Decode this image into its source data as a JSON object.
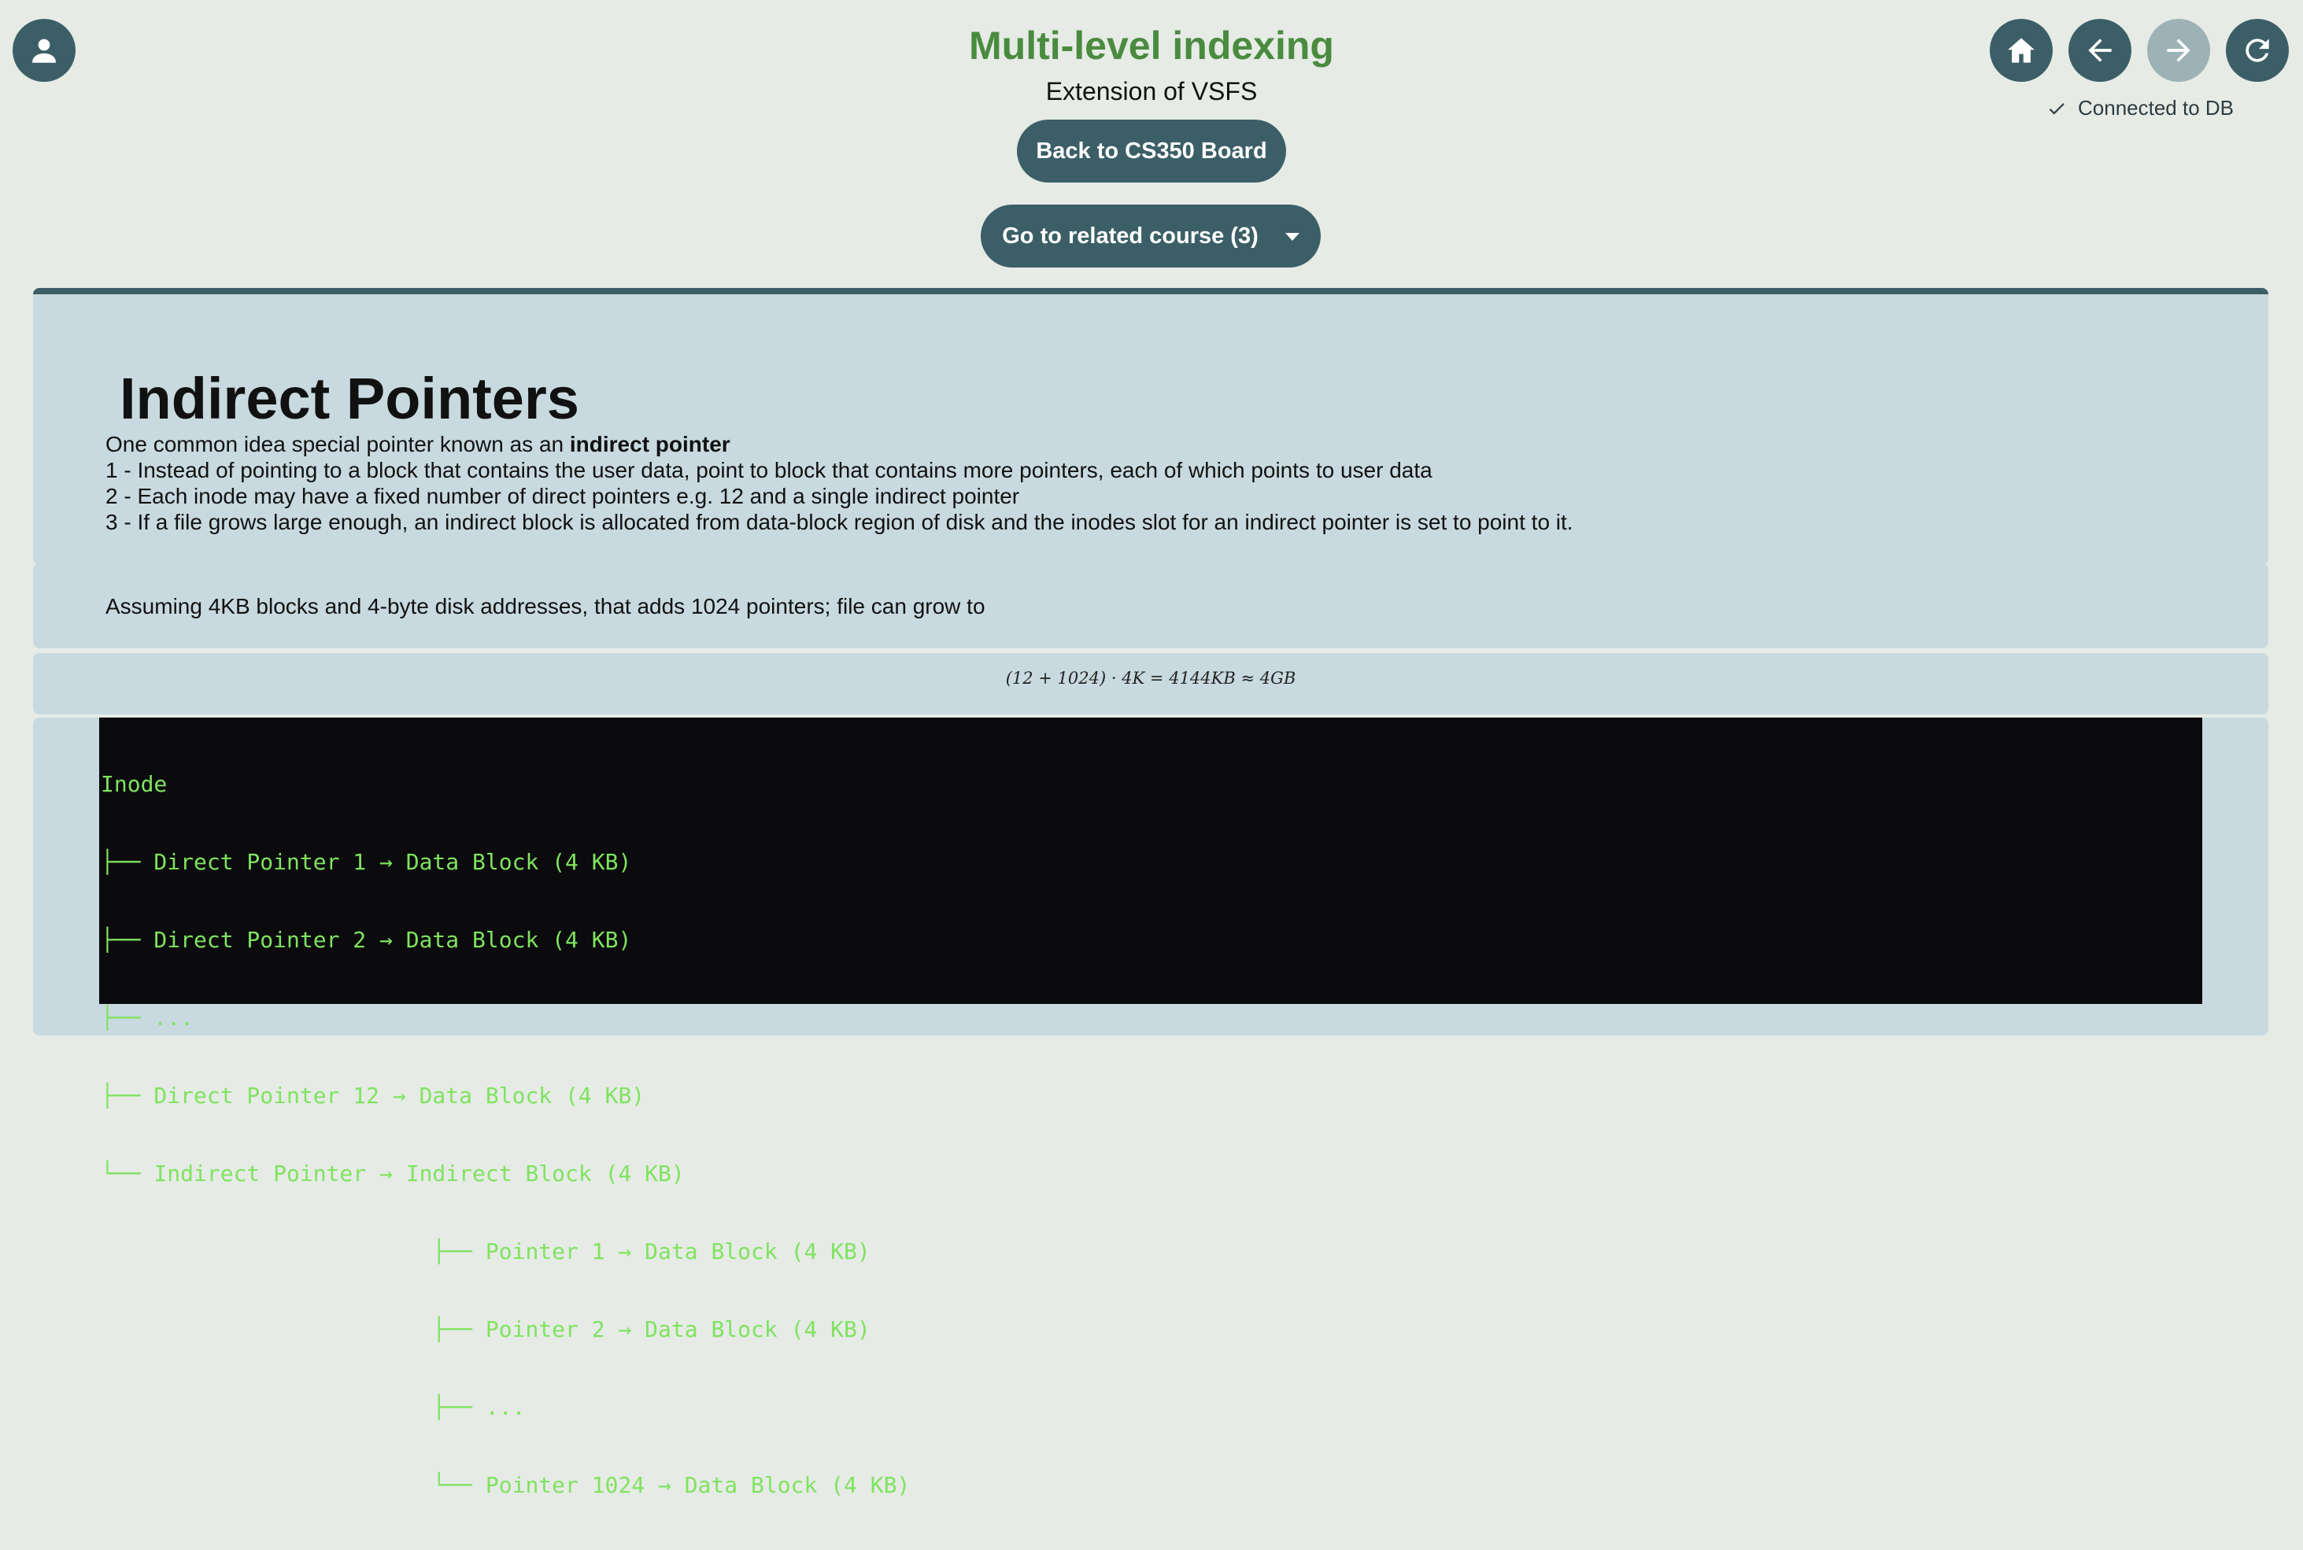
{
  "header": {
    "title": "Multi-level indexing",
    "subtitle": "Extension of VSFS",
    "back_button": "Back to CS350 Board",
    "related_button": "Go to related course (3)",
    "status": "Connected to DB"
  },
  "nav": {
    "icons": [
      "user-icon",
      "home-icon",
      "arrow-left-icon",
      "arrow-right-icon",
      "refresh-icon"
    ],
    "forward_disabled": true
  },
  "colors": {
    "accent": "#3c5f67",
    "title": "#4a8b3f",
    "card": "#c8dadf",
    "code_bg": "#0b0b0d",
    "code_fg": "#7fe35f"
  },
  "content": {
    "heading": "Indirect Pointers",
    "intro_prefix": "One common idea special pointer known as an ",
    "intro_bold": "indirect pointer",
    "points": [
      "1 - Instead of pointing to a block that contains the user data, point to block that contains more pointers, each of which points to user data",
      "2 - Each inode may have a fixed number of direct pointers e.g. 12 and a single indirect pointer",
      "3 - If a file grows large enough, an indirect block is allocated from data-block region of disk and the inodes slot for an indirect pointer is set to point to it."
    ],
    "assumption": "Assuming 4KB blocks and 4-byte disk addresses, that adds 1024 pointers; file can grow to",
    "formula": "(12 + 1024) · 4K = 4144KB ≈ 4GB",
    "code_lines": [
      "Inode",
      "├── Direct Pointer 1 → Data Block (4 KB)",
      "├── Direct Pointer 2 → Data Block (4 KB)",
      "├── ...",
      "├── Direct Pointer 12 → Data Block (4 KB)",
      "└── Indirect Pointer → Indirect Block (4 KB)",
      "                         ├── Pointer 1 → Data Block (4 KB)",
      "                         ├── Pointer 2 → Data Block (4 KB)",
      "                         ├── ...",
      "                         └── Pointer 1024 → Data Block (4 KB)"
    ]
  }
}
